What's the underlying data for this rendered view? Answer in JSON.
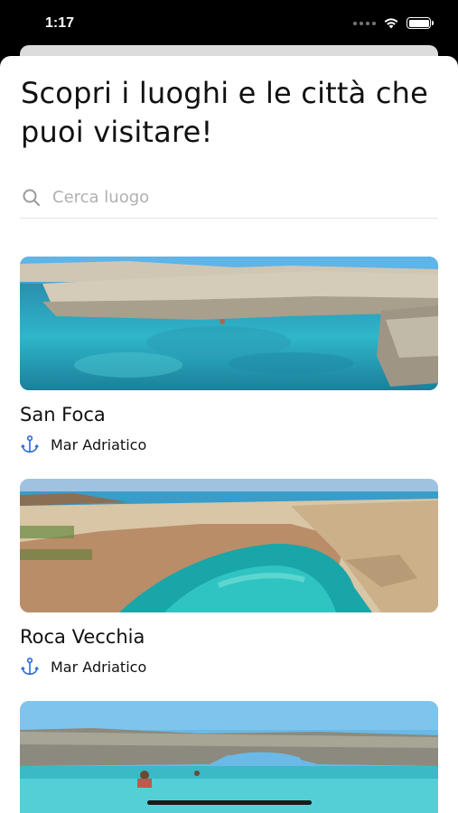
{
  "status": {
    "time": "1:17"
  },
  "header": {
    "title": "Scopri i luoghi e le città che puoi visitare!"
  },
  "search": {
    "placeholder": "Cerca luogo",
    "icon": "search-icon"
  },
  "places": [
    {
      "name": "San Foca",
      "location": "Mar Adriatico",
      "icon": "anchor-icon"
    },
    {
      "name": "Roca Vecchia",
      "location": "Mar Adriatico",
      "icon": "anchor-icon"
    },
    {
      "name": "",
      "location": "",
      "icon": "anchor-icon"
    }
  ],
  "colors": {
    "accent": "#2f6fd6",
    "text": "#111111",
    "placeholder": "#b0b0b0",
    "sea": "#2fb6c9"
  }
}
